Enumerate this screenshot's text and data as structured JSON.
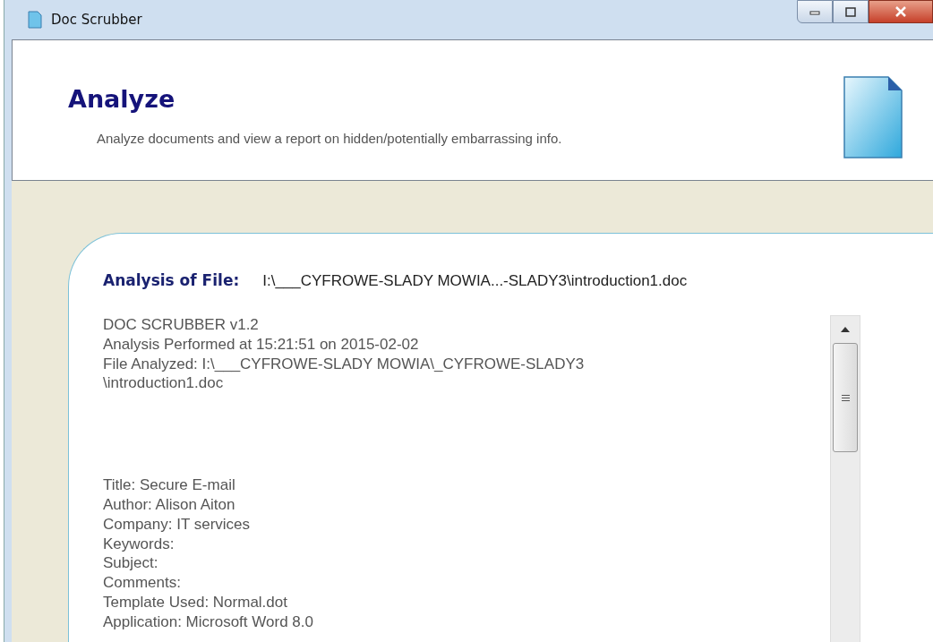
{
  "window": {
    "title": "Doc Scrubber"
  },
  "header": {
    "title": "Analyze",
    "subtitle": "Analyze documents and view a report on hidden/potentially embarrassing info."
  },
  "analysis": {
    "label": "Analysis of File:",
    "file_path": "I:\\___CYFROWE-SLADY MOWIA...-SLADY3\\introduction1.doc"
  },
  "report": {
    "header_lines": [
      "DOC SCRUBBER v1.2",
      "Analysis Performed at 15:21:51 on 2015-02-02",
      "File Analyzed: I:\\___CYFROWE-SLADY MOWIA\\_CYFROWE-SLADY3",
      "\\introduction1.doc"
    ],
    "metadata_lines": [
      "Title: Secure E-mail",
      "Author: Alison Aiton",
      "Company: IT services",
      "Keywords:",
      "Subject:",
      "Comments:",
      "Template Used: Normal.dot",
      "Application: Microsoft Word 8.0"
    ]
  }
}
